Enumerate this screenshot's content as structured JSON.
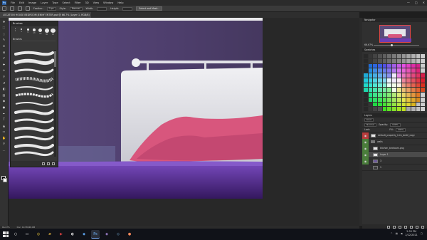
{
  "menubar": {
    "app_icon": "Ps",
    "items": [
      "File",
      "Edit",
      "Image",
      "Layer",
      "Type",
      "Select",
      "Filter",
      "3D",
      "View",
      "Window",
      "Help"
    ],
    "window_controls": {
      "minimize": "—",
      "maximize": "□",
      "close": "✕"
    }
  },
  "options": {
    "feather_label": "Feather:",
    "feather_value": "0 px",
    "style_label": "Style:",
    "style_value": "Normal",
    "width_label": "Width:",
    "height_label": "Height:",
    "select_mask_button": "Select and Mask..."
  },
  "document": {
    "tab_title": "LOCATION HOUSE BEDROOM JENNY ENTER.psd @ 66.7% (Layer 1, RGB/8)"
  },
  "brush_panel": {
    "title": "Brushes",
    "size_presets": [
      "1",
      "5",
      "9",
      "13",
      "20",
      "30",
      "45"
    ],
    "group_name": "Brushes"
  },
  "navigator": {
    "tab": "Navigator",
    "zoom": "66.67%"
  },
  "swatches": {
    "tab": "Swatches"
  },
  "layers": {
    "tab": "Layers",
    "kind_label": "Kind",
    "blend_mode": "Normal",
    "opacity_label": "Opacity:",
    "opacity_value": "100%",
    "lock_label": "Lock:",
    "fill_label": "Fill:",
    "fill_value": "100%",
    "items": [
      {
        "name": "default_property_trim_bed2_copy",
        "visible_color": "red",
        "type": "image"
      },
      {
        "name": "walls",
        "visible_color": "green",
        "type": "folder"
      },
      {
        "name": "kitchen_bedroom.png",
        "visible_color": "green",
        "type": "image"
      },
      {
        "name": "Layer 1",
        "visible_color": "green",
        "type": "image",
        "selected": true
      },
      {
        "name": "3",
        "visible_color": "green",
        "type": "image"
      },
      {
        "name": "1",
        "visible_color": "none",
        "type": "image"
      }
    ]
  },
  "status": {
    "zoom": "66.67%",
    "doc_size": "Doc: 10.5M/48.9M"
  },
  "taskbar": {
    "apps": [
      "search",
      "task-view",
      "chrome",
      "folder",
      "media",
      "steam",
      "store",
      "photoshop",
      "app1",
      "app2",
      "app3"
    ],
    "time": "2:35 PM",
    "date": "2/22/2021",
    "colors": {
      "accent": "#7fb2ff"
    }
  },
  "colors": {
    "wall": "#4d3f6e",
    "pillow": "#d8567d",
    "floor": "#6d3cb3",
    "bed": "#e6e6ea"
  }
}
